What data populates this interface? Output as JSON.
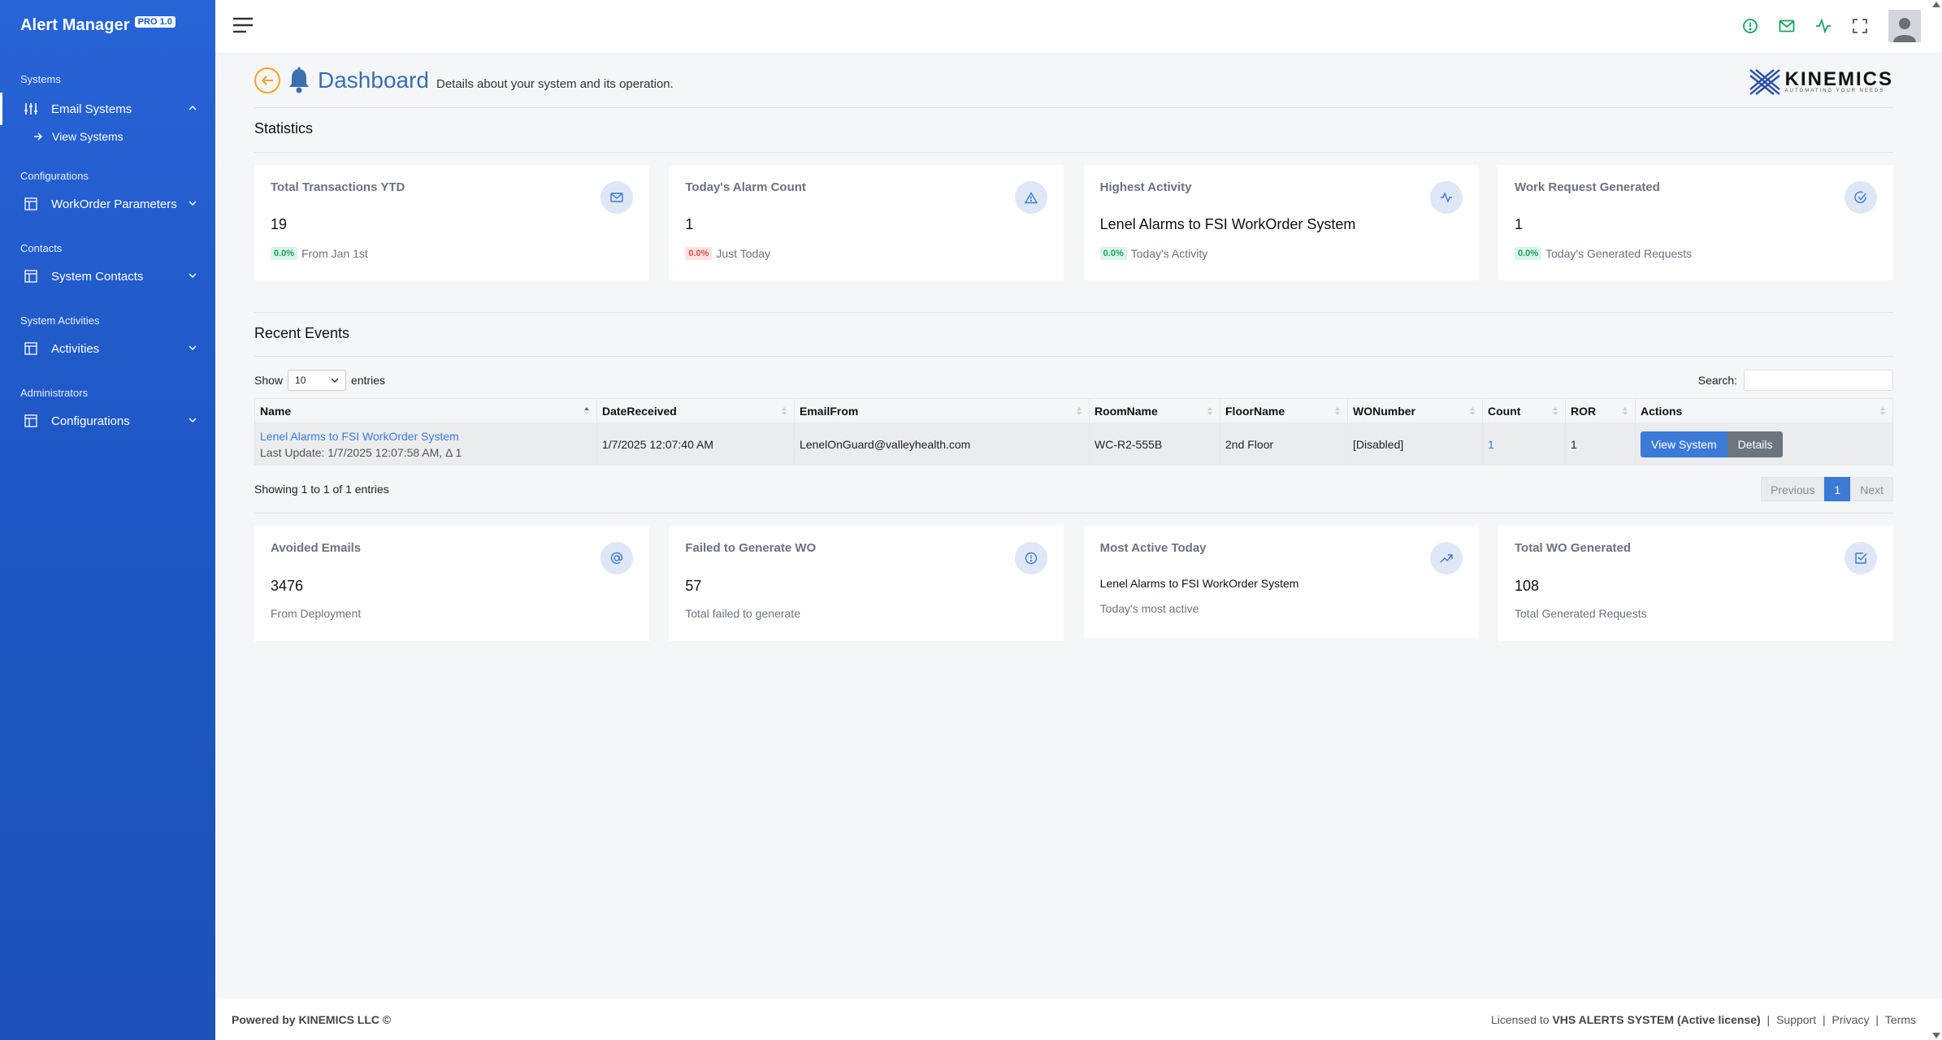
{
  "sidebar": {
    "brand": "Alert Manager",
    "badge": "PRO 1.0",
    "sections": [
      {
        "title": "Systems",
        "item": "Email Systems",
        "sub": "View Systems"
      },
      {
        "title": "Configurations",
        "item": "WorkOrder Parameters"
      },
      {
        "title": "Contacts",
        "item": "System Contacts"
      },
      {
        "title": "System Activities",
        "item": "Activities"
      },
      {
        "title": "Administrators",
        "item": "Configurations"
      }
    ]
  },
  "header": {
    "title": "Dashboard",
    "subtitle": "Details about your system and its operation.",
    "logo_text": "KINEMICS",
    "logo_tag": "AUTOMATING YOUR NEEDS"
  },
  "statistics": {
    "title": "Statistics",
    "cards": [
      {
        "title": "Total Transactions YTD",
        "value": "19",
        "badge": "0.0%",
        "foot": "From Jan 1st",
        "icon": "mail-icon"
      },
      {
        "title": "Today's Alarm Count",
        "value": "1",
        "badge": "0.0%",
        "foot": "Just Today",
        "icon": "alert-triangle-icon"
      },
      {
        "title": "Highest Activity",
        "value": "Lenel Alarms to FSI WorkOrder System",
        "badge": "0.0%",
        "foot": "Today's Activity",
        "icon": "activity-icon"
      },
      {
        "title": "Work Request Generated",
        "value": "1",
        "badge": "0.0%",
        "foot": "Today's Generated Requests",
        "icon": "check-circle-icon"
      }
    ]
  },
  "events": {
    "title": "Recent Events",
    "show_label": "Show",
    "entries_label": "entries",
    "page_length": "10",
    "search_label": "Search:",
    "columns": [
      "Name",
      "DateReceived",
      "EmailFrom",
      "RoomName",
      "FloorName",
      "WONumber",
      "Count",
      "ROR",
      "Actions"
    ],
    "row": {
      "name": "Lenel Alarms to FSI WorkOrder System",
      "last_update": "Last Update: 1/7/2025 12:07:58 AM, Δ 1",
      "date": "1/7/2025 12:07:40 AM",
      "email": "LenelOnGuard@valleyhealth.com",
      "room": "WC-R2-555B",
      "floor": "2nd Floor",
      "wo": "[Disabled]",
      "count": "1",
      "ror": "1",
      "view_btn": "View System",
      "details_btn": "Details"
    },
    "info": "Showing 1 to 1 of 1 entries",
    "prev": "Previous",
    "page": "1",
    "next": "Next"
  },
  "bottom_cards": [
    {
      "title": "Avoided Emails",
      "value": "3476",
      "foot": "From Deployment",
      "icon": "at-icon"
    },
    {
      "title": "Failed to Generate WO",
      "value": "57",
      "foot": "Total failed to generate",
      "icon": "info-circle-icon"
    },
    {
      "title": "Most Active Today",
      "value": "Lenel Alarms to FSI WorkOrder System",
      "foot": "Today's most active",
      "icon": "trending-up-icon"
    },
    {
      "title": "Total WO Generated",
      "value": "108",
      "foot": "Total Generated Requests",
      "icon": "check-square-icon"
    }
  ],
  "footer": {
    "left": "Powered by KINEMICS LLC ©",
    "licensed_prefix": "Licensed to",
    "licensed_to": "VHS ALERTS SYSTEM (Active license)",
    "sep": "|",
    "support": "Support",
    "privacy": "Privacy",
    "terms": "Terms"
  },
  "colors": {
    "sidebar": "#1f59c6",
    "accent": "#3b7ad6",
    "topbar_icons": "#1aa061",
    "back": "#f4a623"
  }
}
